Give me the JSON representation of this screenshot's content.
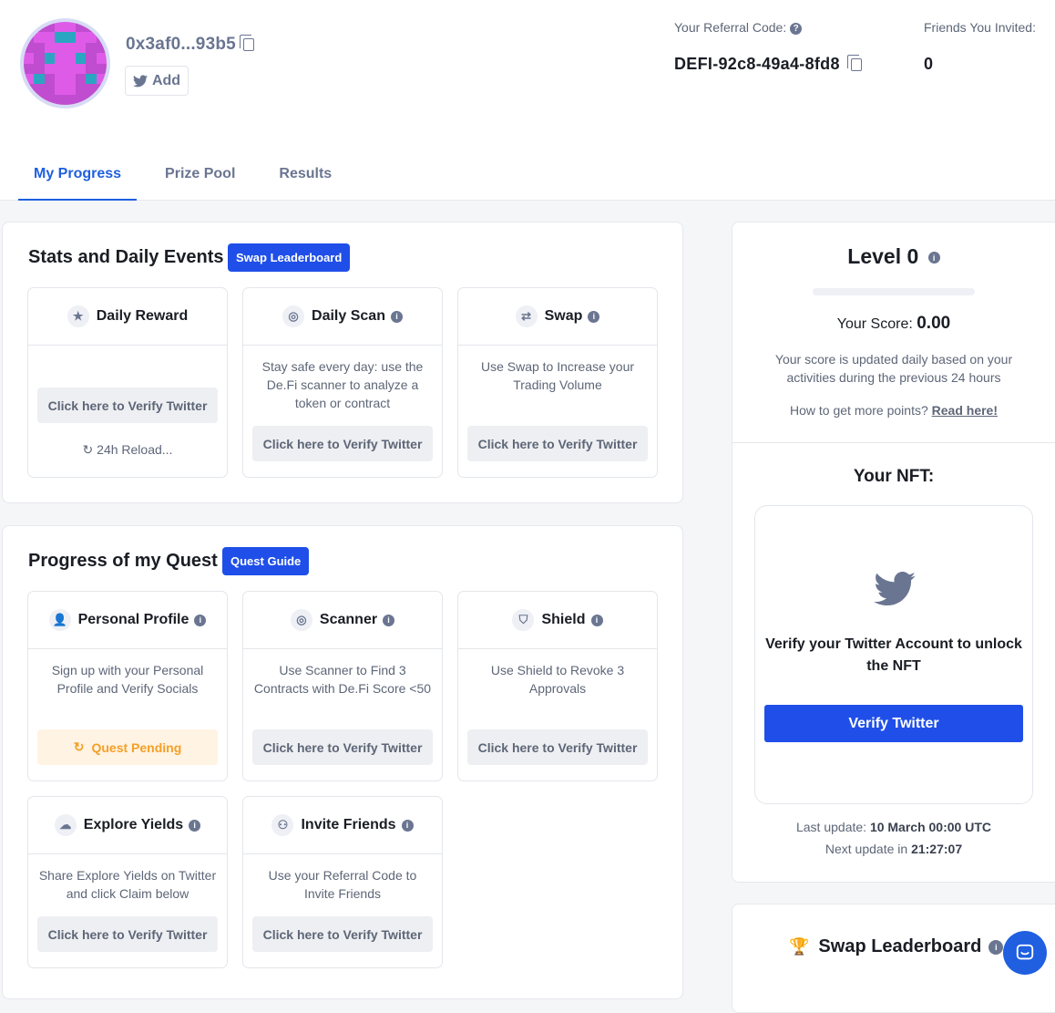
{
  "profile": {
    "address": "0x3af0...93b5",
    "add_label": "Add"
  },
  "referral": {
    "label": "Your Referral Code:",
    "code": "DEFI-92c8-49a4-8fd8",
    "friends_label": "Friends You Invited:",
    "friends_count": "0"
  },
  "tabs": [
    {
      "label": "My Progress"
    },
    {
      "label": "Prize Pool"
    },
    {
      "label": "Results"
    }
  ],
  "stats": {
    "title": "Stats and Daily Events",
    "pill": "Swap Leaderboard",
    "tiles": [
      {
        "title": "Daily Reward",
        "desc": "",
        "button": "Click here to Verify Twitter",
        "reload": "24h Reload..."
      },
      {
        "title": "Daily Scan",
        "desc": "Stay safe every day: use the De.Fi scanner to analyze a token or contract",
        "button": "Click here to Verify Twitter"
      },
      {
        "title": "Swap",
        "desc": "Use Swap to Increase your Trading Volume",
        "button": "Click here to Verify Twitter"
      }
    ]
  },
  "quest": {
    "title": "Progress of my Quest",
    "pill": "Quest Guide",
    "tiles": [
      {
        "title": "Personal Profile",
        "desc": "Sign up with your Personal Profile and Verify Socials",
        "button": "Quest Pending"
      },
      {
        "title": "Scanner",
        "desc": "Use Scanner to Find 3 Contracts with De.Fi Score <50",
        "button": "Click here to Verify Twitter"
      },
      {
        "title": "Shield",
        "desc": "Use Shield to Revoke 3 Approvals",
        "button": "Click here to Verify Twitter"
      },
      {
        "title": "Explore Yields",
        "desc": "Share Explore Yields on Twitter and click Claim below",
        "button": "Click here to Verify Twitter"
      },
      {
        "title": "Invite Friends",
        "desc": "Use your Referral Code to Invite Friends",
        "button": "Click here to Verify Twitter"
      }
    ]
  },
  "level": {
    "title": "Level 0",
    "progress": 0,
    "score_label": "Your Score:",
    "score_value": "0.00",
    "note": "Your score is updated daily based on your activities during the previous 24 hours",
    "howto": "How to get more points?",
    "howto_link": "Read here!"
  },
  "nft": {
    "title": "Your NFT:",
    "text": "Verify your Twitter Account to unlock the NFT",
    "button": "Verify Twitter",
    "last_update_label": "Last update:",
    "last_update_value": "10 March 00:00 UTC",
    "next_update_label": "Next update in",
    "next_update_value": "21:27:07"
  },
  "leaderboard": {
    "title": "Swap Leaderboard"
  },
  "colors": {
    "accent": "#1f4fe8",
    "tab_active": "#1f5fe0",
    "pending": "#f5a026"
  }
}
